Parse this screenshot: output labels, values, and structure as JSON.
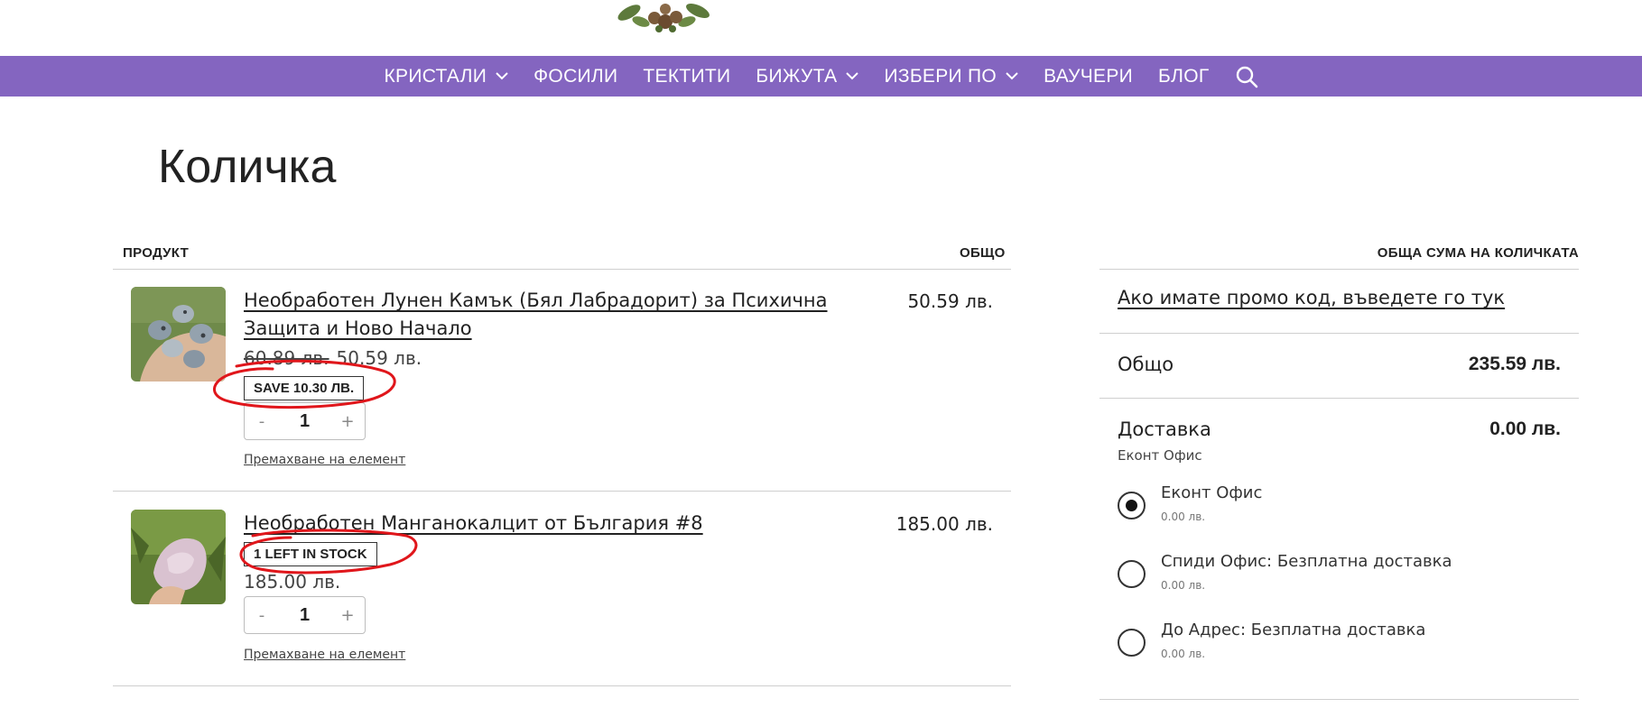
{
  "colors": {
    "nav_bg": "#8465c0",
    "annotation": "#e0161b"
  },
  "nav": {
    "items": [
      {
        "label": "КРИСТАЛИ",
        "has_dropdown": true
      },
      {
        "label": "ФОСИЛИ",
        "has_dropdown": false
      },
      {
        "label": "ТЕКТИТИ",
        "has_dropdown": false
      },
      {
        "label": "БИЖУТА",
        "has_dropdown": true
      },
      {
        "label": "ИЗБЕРИ ПО",
        "has_dropdown": true
      },
      {
        "label": "ВАУЧЕРИ",
        "has_dropdown": false
      },
      {
        "label": "БЛОГ",
        "has_dropdown": false
      }
    ],
    "search_icon": "search-icon"
  },
  "page": {
    "title": "Количка"
  },
  "cart": {
    "col_product": "ПРОДУКТ",
    "col_total": "ОБЩО",
    "items": [
      {
        "name": "Необработен Лунен Камък (Бял Лабрадорит) за Психична Защита и Ново Начало",
        "total": "50.59 лв.",
        "old_price": "60.89 лв.",
        "price": "50.59 лв.",
        "badge": "SAVE 10.30 ЛВ.",
        "qty": "1",
        "qty_minus": "-",
        "qty_plus": "+",
        "remove": "Премахване на елемент"
      },
      {
        "name": "Необработен Манганокалцит от България #8",
        "total": "185.00 лв.",
        "price": "185.00 лв.",
        "badge": "1 LEFT IN STOCK",
        "qty": "1",
        "qty_minus": "-",
        "qty_plus": "+",
        "remove": "Премахване на елемент"
      }
    ]
  },
  "summary": {
    "title": "ОБЩА СУМА НА КОЛИЧКАТА",
    "promo": "Ако имате промо код, въведете го тук",
    "subtotal_label": "Общо",
    "subtotal_value": "235.59 лв.",
    "shipping_label": "Доставка",
    "shipping_value": "0.00 лв.",
    "shipping_selected": "Еконт Офис",
    "options": [
      {
        "label": "Еконт Офис",
        "price": "0.00 лв.",
        "selected": true
      },
      {
        "label": "Спиди Офис: Безплатна доставка",
        "price": "0.00 лв.",
        "selected": false
      },
      {
        "label": "До Адрес: Безплатна доставка",
        "price": "0.00 лв.",
        "selected": false
      }
    ]
  }
}
